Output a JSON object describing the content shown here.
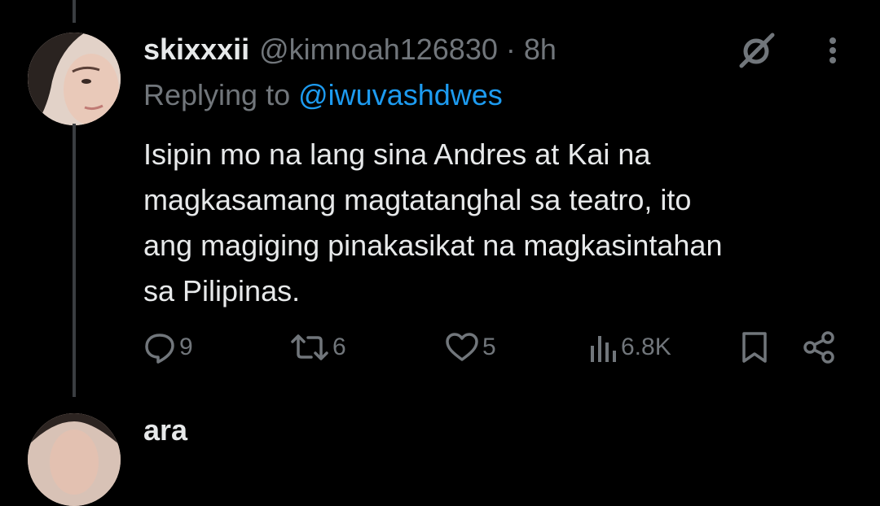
{
  "tweet": {
    "display_name": "skixxxii",
    "handle": "@kimnoah126830",
    "separator": "·",
    "time": "8h",
    "replying_prefix": "Replying to",
    "replying_handle": "@iwuvashdwes",
    "body_lines": [
      "Isipin mo na lang sina Andres at Kai na",
      "magkasamang magtatanghal sa teatro, ito",
      "ang magiging pinakasikat na magkasintahan",
      "sa Pilipinas."
    ],
    "actions": {
      "replies": "9",
      "reposts": "6",
      "likes": "5",
      "views": "6.8K"
    },
    "icons": [
      "grok-icon",
      "more-icon",
      "reply-icon",
      "repost-icon",
      "like-icon",
      "views-icon",
      "bookmark-icon",
      "share-icon"
    ]
  },
  "next_tweet": {
    "display_name_partial": "ara"
  },
  "colors": {
    "background": "#000000",
    "text": "#e7e9ea",
    "secondary": "#71767b",
    "link": "#1d9bf0",
    "thread_line": "#3a3d41"
  }
}
